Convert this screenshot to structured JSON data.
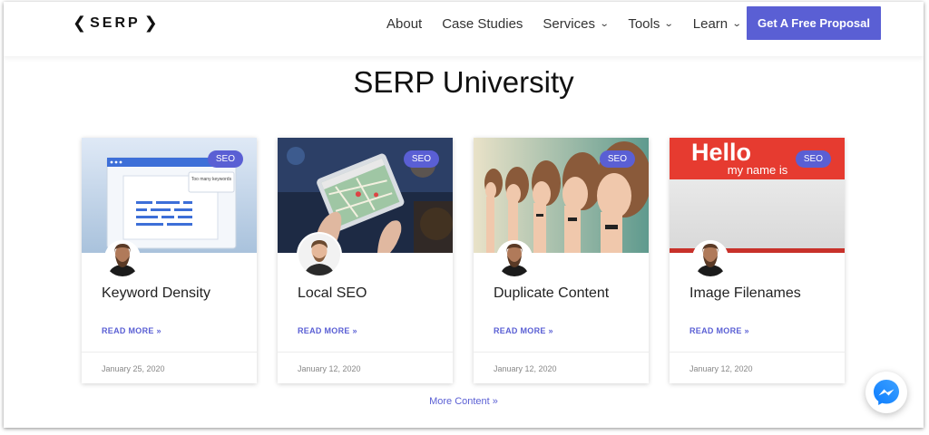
{
  "brand": {
    "logo_left": "❮",
    "logo_text": "SERP",
    "logo_right": "❯"
  },
  "nav": {
    "items": [
      {
        "label": "About",
        "has_dropdown": false
      },
      {
        "label": "Case Studies",
        "has_dropdown": false
      },
      {
        "label": "Services",
        "has_dropdown": true
      },
      {
        "label": "Tools",
        "has_dropdown": true
      },
      {
        "label": "Learn",
        "has_dropdown": true
      }
    ],
    "cta_label": "Get A Free Proposal"
  },
  "page": {
    "title": "SERP University",
    "more_link": "More Content »"
  },
  "cards": [
    {
      "badge": "SEO",
      "title": "Keyword Density",
      "read_more": "READ MORE »",
      "date": "January 25, 2020",
      "image_text": "Too many keywords"
    },
    {
      "badge": "SEO",
      "title": "Local SEO",
      "read_more": "READ MORE »",
      "date": "January 12, 2020"
    },
    {
      "badge": "SEO",
      "title": "Duplicate Content",
      "read_more": "READ MORE »",
      "date": "January 12, 2020"
    },
    {
      "badge": "SEO",
      "title": "Image Filenames",
      "read_more": "READ MORE »",
      "date": "January 12, 2020",
      "image_text_1": "Hello",
      "image_text_2": "my name is"
    }
  ],
  "colors": {
    "accent": "#5a5fd4",
    "text": "#222222",
    "muted": "#888888"
  }
}
